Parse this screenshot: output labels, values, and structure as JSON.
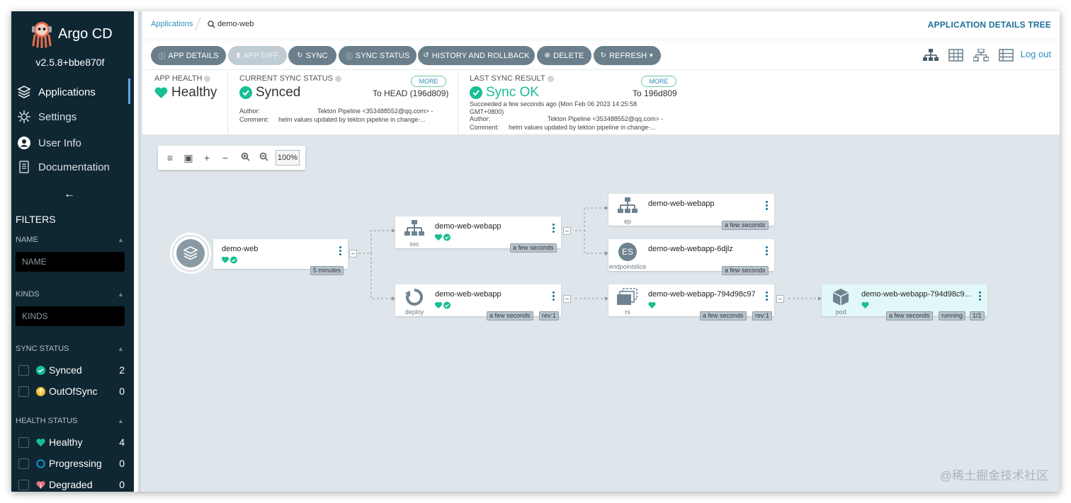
{
  "app": {
    "name": "Argo CD",
    "version": "v2.5.8+bbe870f"
  },
  "nav": [
    {
      "label": "Applications",
      "icon": "layers-icon"
    },
    {
      "label": "Settings",
      "icon": "gear-icon"
    },
    {
      "label": "User Info",
      "icon": "user-icon"
    },
    {
      "label": "Documentation",
      "icon": "book-icon"
    }
  ],
  "filters": {
    "title": "FILTERS",
    "name_label": "NAME",
    "name_placeholder": "NAME",
    "kinds_label": "KINDS",
    "kinds_placeholder": "KINDS",
    "sync_status_label": "SYNC STATUS",
    "sync_status": [
      {
        "label": "Synced",
        "count": "2"
      },
      {
        "label": "OutOfSync",
        "count": "0"
      }
    ],
    "health_status_label": "HEALTH STATUS",
    "health_status": [
      {
        "label": "Healthy",
        "count": "4"
      },
      {
        "label": "Progressing",
        "count": "0"
      },
      {
        "label": "Degraded",
        "count": "0"
      }
    ]
  },
  "breadcrumb": {
    "root": "Applications",
    "current": "demo-web"
  },
  "page_kind": "APPLICATION DETAILS TREE",
  "toolbar": {
    "app_details": "APP DETAILS",
    "app_diff": "APP DIFF",
    "sync": "SYNC",
    "sync_status": "SYNC STATUS",
    "history": "HISTORY AND ROLLBACK",
    "delete": "DELETE",
    "refresh": "REFRESH",
    "logout": "Log out"
  },
  "status": {
    "health_title": "APP HEALTH",
    "health_value": "Healthy",
    "sync_title": "CURRENT SYNC STATUS",
    "sync_value": "Synced",
    "sync_target": "To HEAD (196d809)",
    "sync_author_label": "Author:",
    "sync_author": "Tekton Pipeline <353488552@qq.com> -",
    "sync_comment_label": "Comment:",
    "sync_comment": "helm values updated by tekton pipeline in change-...",
    "more": "MORE",
    "result_title": "LAST SYNC RESULT",
    "result_value": "Sync OK",
    "result_target": "To 196d809",
    "result_detail": "Succeeded a few seconds ago (Mon Feb 06 2023 14:25:58",
    "result_detail2": "GMT+0800)",
    "result_author_label": "Author:",
    "result_author": "Tekton Pipeline <353488552@qq.com> -",
    "result_comment_label": "Comment:",
    "result_comment": "helm values updated by tekton pipeline in change-..."
  },
  "zoom": "100%",
  "nodes": {
    "app": {
      "name": "demo-web",
      "tags": [
        "5 minutes"
      ]
    },
    "svc": {
      "name": "demo-web-webapp",
      "kind": "svc",
      "tags": [
        "a few seconds"
      ]
    },
    "deploy": {
      "name": "demo-web-webapp",
      "kind": "deploy",
      "tags": [
        "a few seconds",
        "rev:1"
      ]
    },
    "ep": {
      "name": "demo-web-webapp",
      "kind": "ep",
      "tags": [
        "a few seconds"
      ]
    },
    "es": {
      "name": "demo-web-webapp-6djlz",
      "kind": "endpointslice",
      "icon_text": "ES",
      "tags": [
        "a few seconds"
      ]
    },
    "rs": {
      "name": "demo-web-webapp-794d98c97",
      "kind": "rs",
      "tags": [
        "a few seconds",
        "rev:1"
      ]
    },
    "pod": {
      "name": "demo-web-webapp-794d98c9...",
      "kind": "pod",
      "tags": [
        "a few seconds",
        "running",
        "1/1"
      ]
    }
  },
  "watermark": "@稀土掘金技术社区",
  "colors": {
    "sidebar": "#0f2733",
    "healthy": "#18be94",
    "accent": "#2f8ec0",
    "button": "#6a7f8b"
  }
}
